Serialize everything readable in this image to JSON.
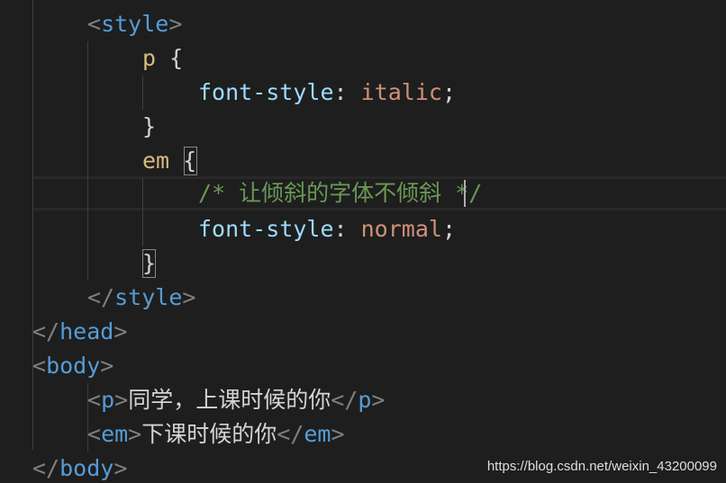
{
  "editor": {
    "lines": [
      {
        "tokens": [
          {
            "c": "punc",
            "t": "<"
          },
          {
            "c": "tag",
            "t": "style"
          },
          {
            "c": "punc",
            "t": ">"
          }
        ]
      },
      {
        "tokens": [
          {
            "c": "sel",
            "t": "p"
          },
          {
            "c": "brace",
            "t": " {"
          }
        ]
      },
      {
        "tokens": [
          {
            "c": "prop",
            "t": "font-style"
          },
          {
            "c": "text",
            "t": ": "
          },
          {
            "c": "val",
            "t": "italic"
          },
          {
            "c": "text",
            "t": ";"
          }
        ]
      },
      {
        "tokens": [
          {
            "c": "brace",
            "t": "}"
          }
        ]
      },
      {
        "tokens": [
          {
            "c": "sel",
            "t": "em"
          },
          {
            "c": "text",
            "t": " "
          },
          {
            "c": "brace",
            "t": "{"
          }
        ]
      },
      {
        "tokens": [
          {
            "c": "comment",
            "t": "/* 让倾斜的字体不倾斜 */"
          }
        ]
      },
      {
        "tokens": [
          {
            "c": "prop",
            "t": "font-style"
          },
          {
            "c": "text",
            "t": ": "
          },
          {
            "c": "val",
            "t": "normal"
          },
          {
            "c": "text",
            "t": ";"
          }
        ]
      },
      {
        "tokens": [
          {
            "c": "brace",
            "t": "}"
          }
        ]
      },
      {
        "tokens": [
          {
            "c": "punc",
            "t": "</"
          },
          {
            "c": "tag",
            "t": "style"
          },
          {
            "c": "punc",
            "t": ">"
          }
        ]
      },
      {
        "tokens": [
          {
            "c": "punc",
            "t": "</"
          },
          {
            "c": "tag",
            "t": "head"
          },
          {
            "c": "punc",
            "t": ">"
          }
        ]
      },
      {
        "tokens": [
          {
            "c": "punc",
            "t": "<"
          },
          {
            "c": "tag",
            "t": "body"
          },
          {
            "c": "punc",
            "t": ">"
          }
        ]
      },
      {
        "tokens": [
          {
            "c": "punc",
            "t": "<"
          },
          {
            "c": "tag",
            "t": "p"
          },
          {
            "c": "punc",
            "t": ">"
          },
          {
            "c": "text",
            "t": "同学，上课时候的你"
          },
          {
            "c": "punc",
            "t": "</"
          },
          {
            "c": "tag",
            "t": "p"
          },
          {
            "c": "punc",
            "t": ">"
          }
        ]
      },
      {
        "tokens": [
          {
            "c": "punc",
            "t": "<"
          },
          {
            "c": "tag",
            "t": "em"
          },
          {
            "c": "punc",
            "t": ">"
          },
          {
            "c": "text",
            "t": "下课时候的你"
          },
          {
            "c": "punc",
            "t": "</"
          },
          {
            "c": "tag",
            "t": "em"
          },
          {
            "c": "punc",
            "t": ">"
          }
        ]
      },
      {
        "tokens": [
          {
            "c": "punc",
            "t": "</"
          },
          {
            "c": "tag",
            "t": "body"
          },
          {
            "c": "punc",
            "t": ">"
          }
        ]
      }
    ]
  },
  "watermark": "https://blog.csdn.net/weixin_43200099",
  "colors": {
    "background": "#1e1e1e",
    "tag": "#569cd6",
    "punctuation": "#808080",
    "selector": "#d7ba7d",
    "property": "#9cdcfe",
    "value": "#ce9178",
    "comment": "#6a9955",
    "text": "#d4d4d4"
  }
}
